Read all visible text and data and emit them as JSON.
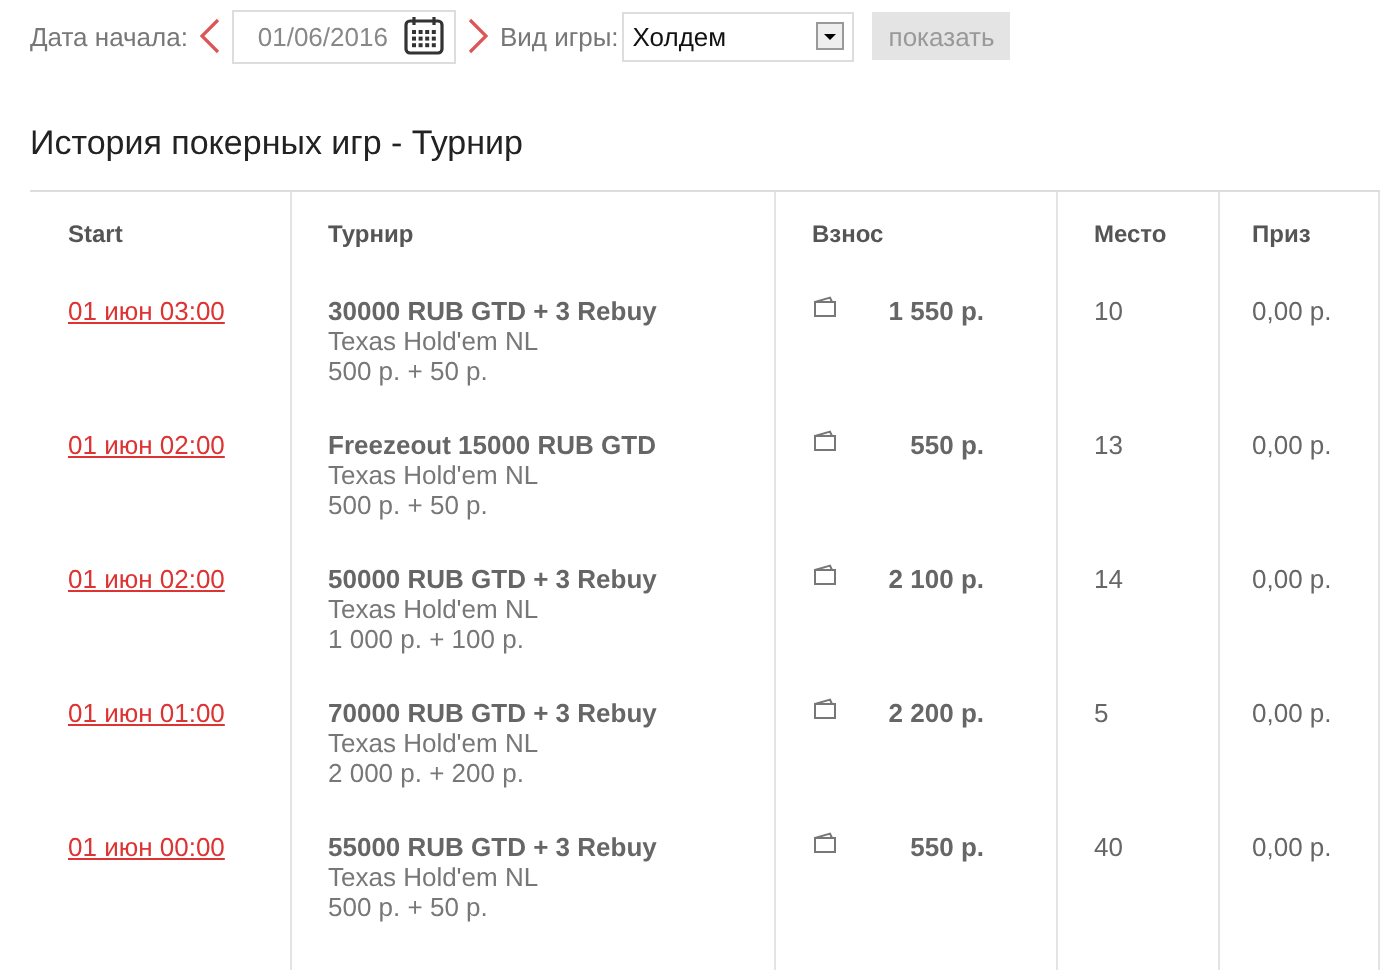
{
  "filters": {
    "date_label": "Дата начала:",
    "date_value": "01/06/2016",
    "game_label": "Вид игры:",
    "game_value": "Холдем",
    "show_button": {
      "label": "показать",
      "disabled": true
    }
  },
  "title": "История покерных игр - Турнир",
  "table": {
    "columns": [
      "Start",
      "Турнир",
      "Взнос",
      "Место",
      "Приз"
    ],
    "rows": [
      {
        "start": "01 июн 03:00",
        "name": "30000 RUB GTD + 3 Rebuy",
        "game": "Texas Hold'em NL",
        "buyin": "500 р. + 50 р.",
        "fee": "1 550 р.",
        "place": "10",
        "prize": "0,00 р."
      },
      {
        "start": "01 июн 02:00",
        "name": "Freezeout 15000 RUB GTD",
        "game": "Texas Hold'em NL",
        "buyin": "500 р. + 50 р.",
        "fee": "550 р.",
        "place": "13",
        "prize": "0,00 р."
      },
      {
        "start": "01 июн 02:00",
        "name": "50000 RUB GTD + 3 Rebuy",
        "game": "Texas Hold'em NL",
        "buyin": "1 000 р. + 100 р.",
        "fee": "2 100 р.",
        "place": "14",
        "prize": "0,00 р."
      },
      {
        "start": "01 июн 01:00",
        "name": "70000 RUB GTD + 3 Rebuy",
        "game": "Texas Hold'em NL",
        "buyin": "2 000 р. + 200 р.",
        "fee": "2 200 р.",
        "place": "5",
        "prize": "0,00 р."
      },
      {
        "start": "01 июн 00:00",
        "name": "55000 RUB GTD + 3 Rebuy",
        "game": "Texas Hold'em NL",
        "buyin": "500 р. + 50 р.",
        "fee": "550 р.",
        "place": "40",
        "prize": "0,00 р."
      }
    ]
  }
}
